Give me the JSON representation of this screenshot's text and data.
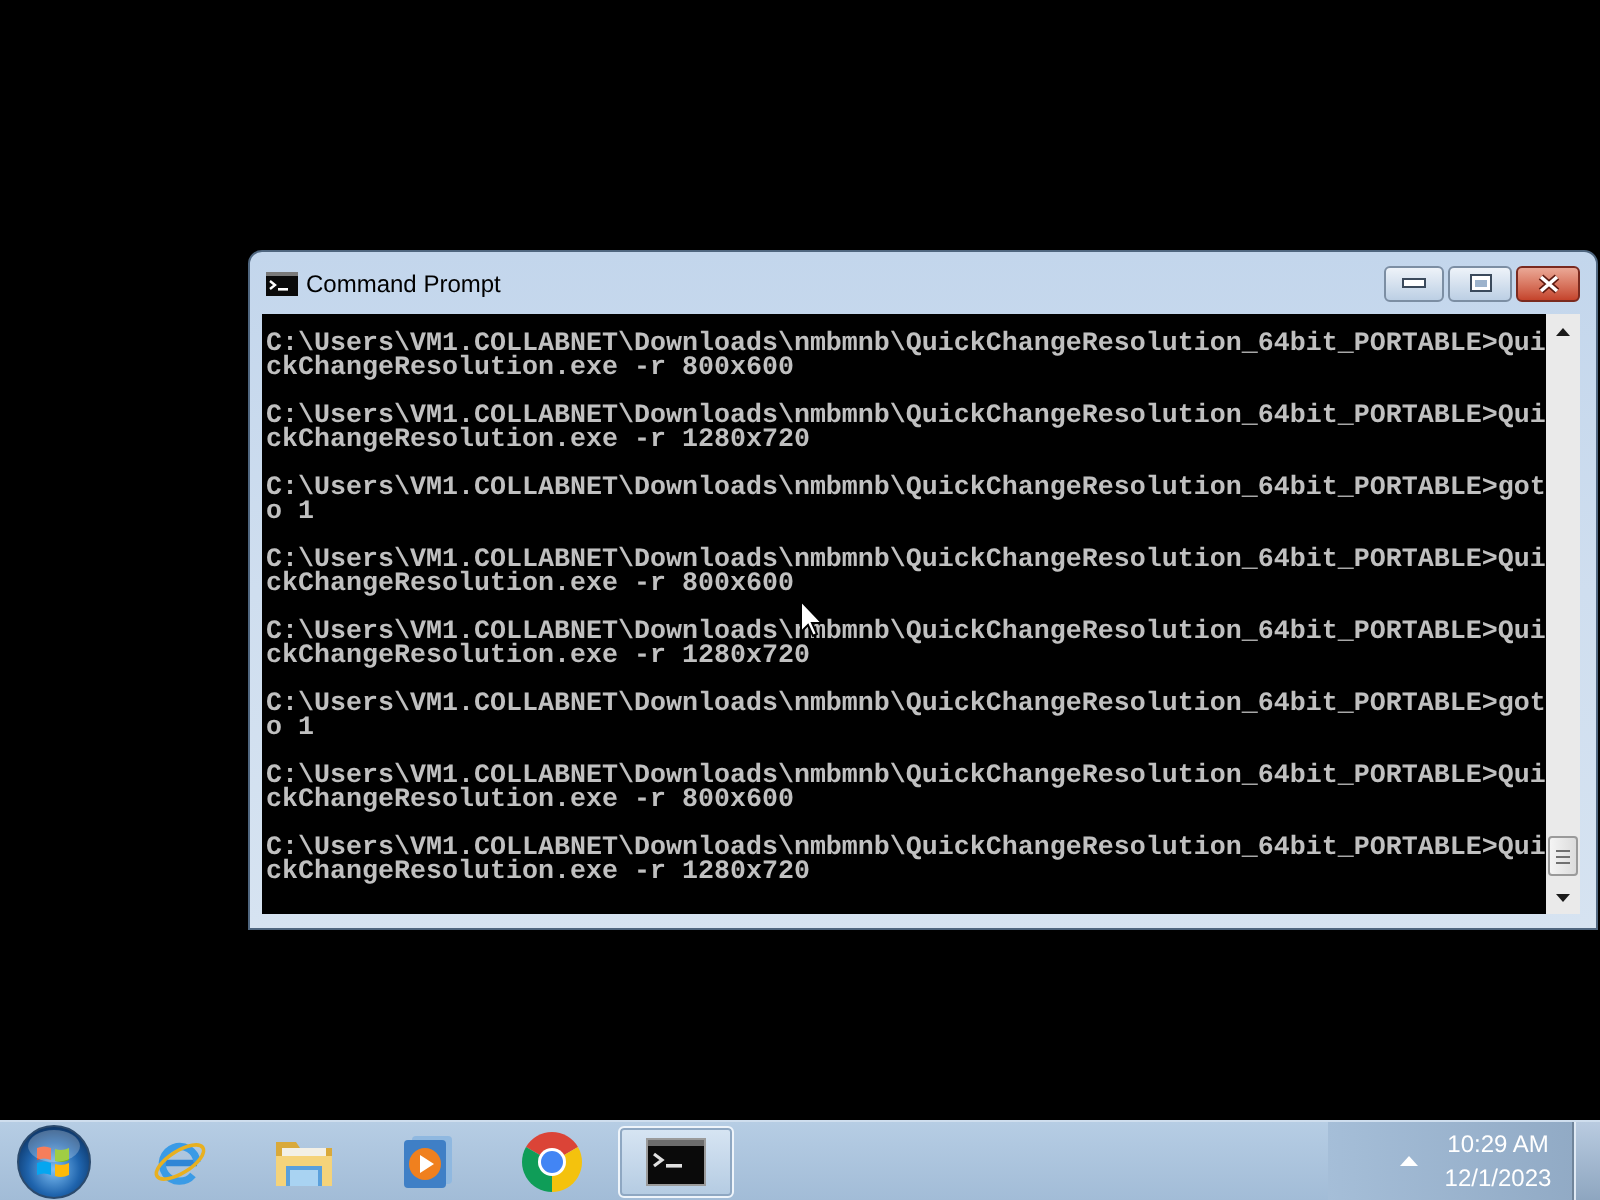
{
  "window": {
    "title": "Command Prompt",
    "console": {
      "entries": [
        "C:\\Users\\VM1.COLLABNET\\Downloads\\nmbmnb\\QuickChangeResolution_64bit_PORTABLE>QuickChangeResolution.exe -r 800x600",
        "C:\\Users\\VM1.COLLABNET\\Downloads\\nmbmnb\\QuickChangeResolution_64bit_PORTABLE>QuickChangeResolution.exe -r 1280x720",
        "C:\\Users\\VM1.COLLABNET\\Downloads\\nmbmnb\\QuickChangeResolution_64bit_PORTABLE>goto 1",
        "C:\\Users\\VM1.COLLABNET\\Downloads\\nmbmnb\\QuickChangeResolution_64bit_PORTABLE>QuickChangeResolution.exe -r 800x600",
        "C:\\Users\\VM1.COLLABNET\\Downloads\\nmbmnb\\QuickChangeResolution_64bit_PORTABLE>QuickChangeResolution.exe -r 1280x720",
        "C:\\Users\\VM1.COLLABNET\\Downloads\\nmbmnb\\QuickChangeResolution_64bit_PORTABLE>goto 1",
        "C:\\Users\\VM1.COLLABNET\\Downloads\\nmbmnb\\QuickChangeResolution_64bit_PORTABLE>QuickChangeResolution.exe -r 800x600",
        "C:\\Users\\VM1.COLLABNET\\Downloads\\nmbmnb\\QuickChangeResolution_64bit_PORTABLE>QuickChangeResolution.exe -r 1280x720"
      ]
    }
  },
  "taskbar": {
    "items": [
      {
        "kind": "browser",
        "selected": false
      },
      {
        "kind": "files",
        "selected": false
      },
      {
        "kind": "media",
        "selected": false
      },
      {
        "kind": "webring",
        "selected": false
      },
      {
        "kind": "console",
        "selected": true
      }
    ],
    "clock": {
      "time": "10:29 AM",
      "date": "12/1/2023"
    }
  }
}
